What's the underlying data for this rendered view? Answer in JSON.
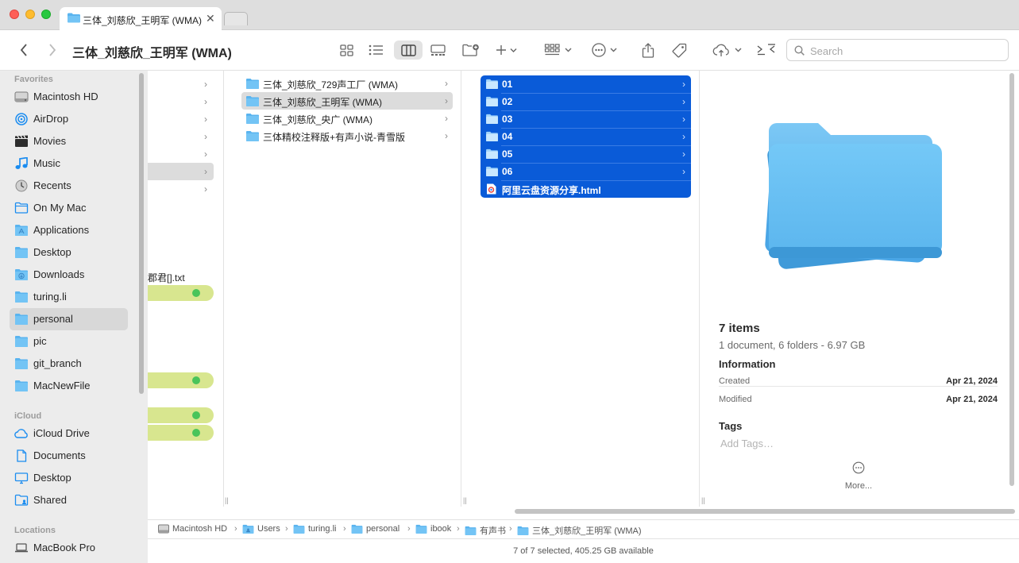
{
  "window": {
    "tab_title": "三体_刘慈欣_王明军 (WMA)",
    "title": "三体_刘慈欣_王明军 (WMA)",
    "search_placeholder": "Search"
  },
  "sidebar": {
    "favorites_header": "Favorites",
    "favorites": [
      {
        "label": "Macintosh HD",
        "icon": "hard-drive-icon"
      },
      {
        "label": "AirDrop",
        "icon": "airdrop-icon"
      },
      {
        "label": "Movies",
        "icon": "clapperboard-icon"
      },
      {
        "label": "Music",
        "icon": "music-note-icon"
      },
      {
        "label": "Recents",
        "icon": "clock-icon"
      },
      {
        "label": "On My Mac",
        "icon": "folder-outline-icon"
      },
      {
        "label": "Applications",
        "icon": "applications-folder-icon"
      },
      {
        "label": "Desktop",
        "icon": "folder-icon"
      },
      {
        "label": "Downloads",
        "icon": "downloads-folder-icon"
      },
      {
        "label": "turing.li",
        "icon": "folder-icon"
      },
      {
        "label": "personal",
        "icon": "folder-icon"
      },
      {
        "label": "pic",
        "icon": "folder-icon"
      },
      {
        "label": "git_branch",
        "icon": "folder-icon"
      },
      {
        "label": "MacNewFile",
        "icon": "folder-icon"
      }
    ],
    "icloud_header": "iCloud",
    "icloud": [
      {
        "label": "iCloud Drive",
        "icon": "cloud-icon"
      },
      {
        "label": "Documents",
        "icon": "document-icon"
      },
      {
        "label": "Desktop",
        "icon": "desktop-icon"
      },
      {
        "label": "Shared",
        "icon": "shared-folder-icon"
      }
    ],
    "locations_header": "Locations",
    "locations": [
      {
        "label": "MacBook Pro",
        "icon": "laptop-icon"
      }
    ]
  },
  "column1": {
    "partial_file": "郡君[].txt"
  },
  "column2": {
    "items": [
      "三体_刘慈欣_729声工厂 (WMA)",
      "三体_刘慈欣_王明军 (WMA)",
      "三体_刘慈欣_央广 (WMA)",
      "三体精校注释版+有声小说-青雪版"
    ]
  },
  "column3": {
    "items": [
      "01",
      "02",
      "03",
      "04",
      "05",
      "06"
    ],
    "file": "阿里云盘资源分享.html"
  },
  "preview": {
    "count": "7 items",
    "summary": "1 document, 6 folders - 6.97 GB",
    "info_header": "Information",
    "created_label": "Created",
    "created_value": "Apr 21, 2024",
    "modified_label": "Modified",
    "modified_value": "Apr 21, 2024",
    "tags_header": "Tags",
    "tags_placeholder": "Add Tags…",
    "more_label": "More..."
  },
  "pathbar": [
    "Macintosh HD",
    "Users",
    "turing.li",
    "personal",
    "ibook",
    "有声书",
    "三体_刘慈欣_王明军 (WMA)"
  ],
  "status": "7 of 7 selected, 405.25 GB available",
  "colors": {
    "selection": "#0a5bd8",
    "folder": "#5ab4ef",
    "tag_green": "#49c45a",
    "tag_bg": "#d8e68f"
  }
}
